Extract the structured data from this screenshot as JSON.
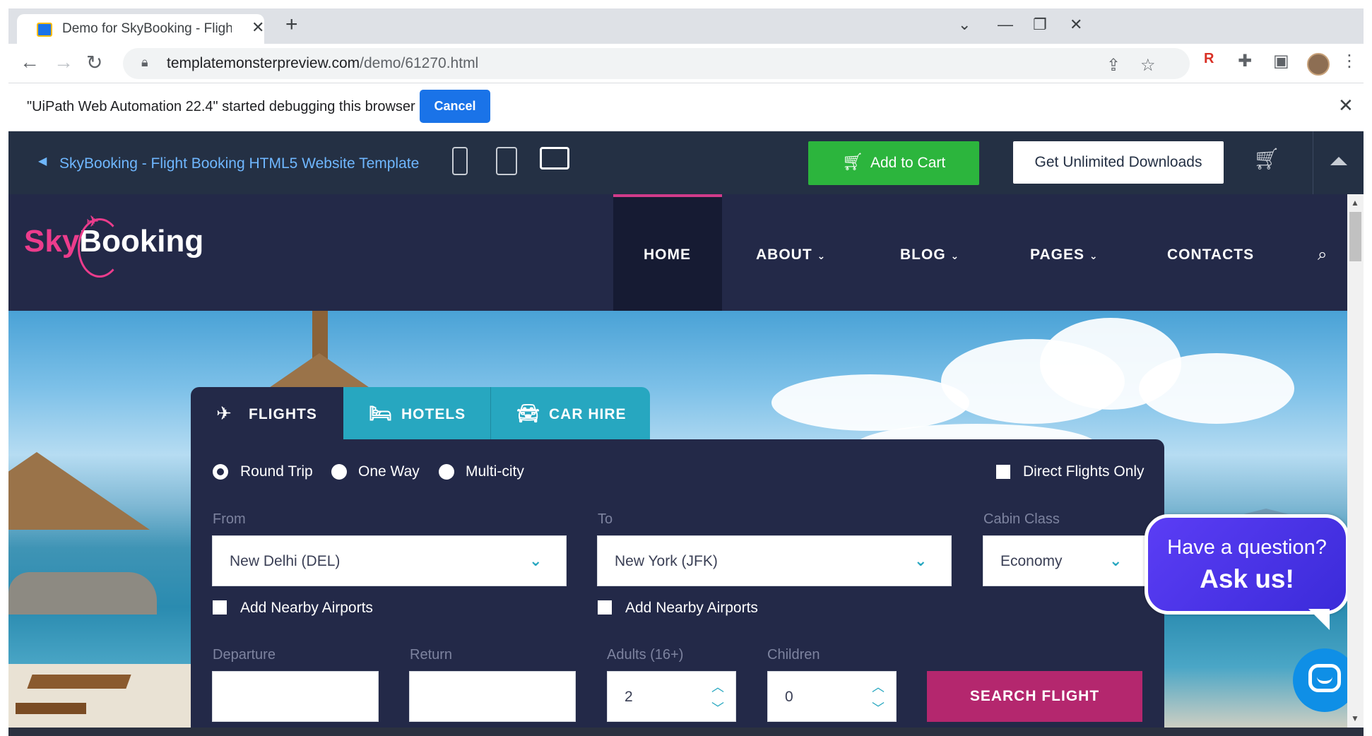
{
  "browser": {
    "tab_title": "Demo for SkyBooking - Flight Bo",
    "new_tab_symbol": "+",
    "url_domain": "templatemonsterpreview.com",
    "url_path": "/demo/61270.html",
    "infobar_message": "\"UiPath Web Automation 22.4\" started debugging this browser",
    "infobar_cancel": "Cancel"
  },
  "preview_bar": {
    "template_name": "SkyBooking - Flight Booking HTML5 Website Template",
    "add_to_cart": "Add to Cart",
    "unlimited": "Get Unlimited Downloads"
  },
  "site": {
    "logo_sky": "Sky",
    "logo_booking": "Booking",
    "nav": {
      "home": "HOME",
      "about": "ABOUT",
      "blog": "BLOG",
      "pages": "PAGES",
      "contacts": "CONTACTS"
    }
  },
  "booking": {
    "tabs": {
      "flights": "FLIGHTS",
      "hotels": "HOTELS",
      "car_hire": "CAR HIRE"
    },
    "trip_types": {
      "round_trip": "Round Trip",
      "one_way": "One Way",
      "multi_city": "Multi-city"
    },
    "selected_trip": "Round Trip",
    "direct_only": "Direct Flights Only",
    "from_label": "From",
    "from_value": "New Delhi (DEL)",
    "to_label": "To",
    "to_value": "New York (JFK)",
    "cabin_label": "Cabin Class",
    "cabin_value": "Economy",
    "nearby_from": "Add Nearby Airports",
    "nearby_to": "Add Nearby Airports",
    "departure_label": "Departure",
    "return_label": "Return",
    "adults_label": "Adults (16+)",
    "adults_value": "2",
    "children_label": "Children",
    "children_value": "0",
    "search_button": "SEARCH FLIGHT"
  },
  "chat": {
    "question": "Have a question?",
    "ask": "Ask us!"
  },
  "colors": {
    "navy": "#232948",
    "teal_tab": "#27a7c0",
    "accent_pink": "#ec3c8c",
    "search_button": "#b4276e",
    "add_to_cart_green": "#2cb53d"
  },
  "icons": [
    "search-icon",
    "plane-icon",
    "bed-icon",
    "car-icon",
    "cart-icon",
    "chat-icon",
    "chevron-down-icon",
    "lock-icon"
  ]
}
